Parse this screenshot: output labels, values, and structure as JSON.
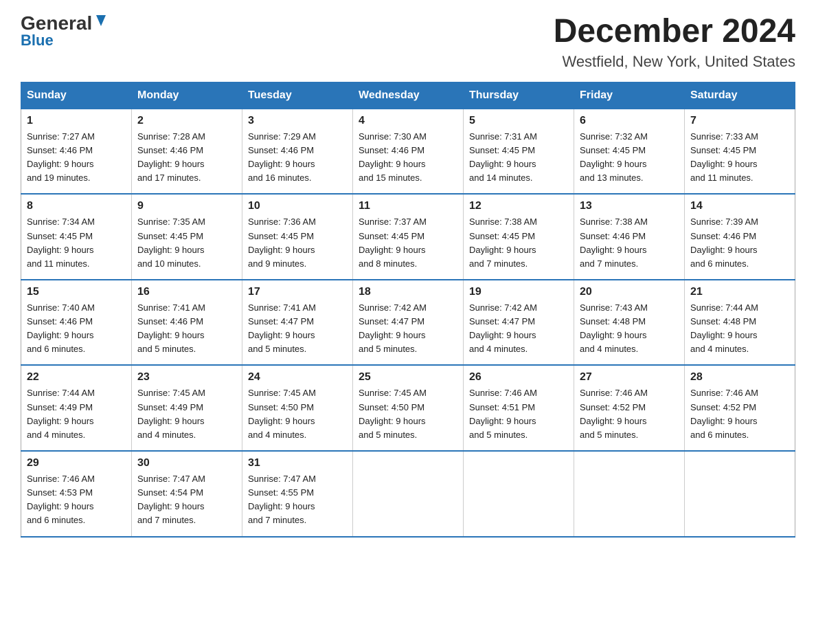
{
  "header": {
    "logo_general": "General",
    "logo_blue": "Blue",
    "month_title": "December 2024",
    "location": "Westfield, New York, United States"
  },
  "days_of_week": [
    "Sunday",
    "Monday",
    "Tuesday",
    "Wednesday",
    "Thursday",
    "Friday",
    "Saturday"
  ],
  "weeks": [
    [
      {
        "day": "1",
        "sunrise": "7:27 AM",
        "sunset": "4:46 PM",
        "daylight": "9 hours and 19 minutes."
      },
      {
        "day": "2",
        "sunrise": "7:28 AM",
        "sunset": "4:46 PM",
        "daylight": "9 hours and 17 minutes."
      },
      {
        "day": "3",
        "sunrise": "7:29 AM",
        "sunset": "4:46 PM",
        "daylight": "9 hours and 16 minutes."
      },
      {
        "day": "4",
        "sunrise": "7:30 AM",
        "sunset": "4:46 PM",
        "daylight": "9 hours and 15 minutes."
      },
      {
        "day": "5",
        "sunrise": "7:31 AM",
        "sunset": "4:45 PM",
        "daylight": "9 hours and 14 minutes."
      },
      {
        "day": "6",
        "sunrise": "7:32 AM",
        "sunset": "4:45 PM",
        "daylight": "9 hours and 13 minutes."
      },
      {
        "day": "7",
        "sunrise": "7:33 AM",
        "sunset": "4:45 PM",
        "daylight": "9 hours and 11 minutes."
      }
    ],
    [
      {
        "day": "8",
        "sunrise": "7:34 AM",
        "sunset": "4:45 PM",
        "daylight": "9 hours and 11 minutes."
      },
      {
        "day": "9",
        "sunrise": "7:35 AM",
        "sunset": "4:45 PM",
        "daylight": "9 hours and 10 minutes."
      },
      {
        "day": "10",
        "sunrise": "7:36 AM",
        "sunset": "4:45 PM",
        "daylight": "9 hours and 9 minutes."
      },
      {
        "day": "11",
        "sunrise": "7:37 AM",
        "sunset": "4:45 PM",
        "daylight": "9 hours and 8 minutes."
      },
      {
        "day": "12",
        "sunrise": "7:38 AM",
        "sunset": "4:45 PM",
        "daylight": "9 hours and 7 minutes."
      },
      {
        "day": "13",
        "sunrise": "7:38 AM",
        "sunset": "4:46 PM",
        "daylight": "9 hours and 7 minutes."
      },
      {
        "day": "14",
        "sunrise": "7:39 AM",
        "sunset": "4:46 PM",
        "daylight": "9 hours and 6 minutes."
      }
    ],
    [
      {
        "day": "15",
        "sunrise": "7:40 AM",
        "sunset": "4:46 PM",
        "daylight": "9 hours and 6 minutes."
      },
      {
        "day": "16",
        "sunrise": "7:41 AM",
        "sunset": "4:46 PM",
        "daylight": "9 hours and 5 minutes."
      },
      {
        "day": "17",
        "sunrise": "7:41 AM",
        "sunset": "4:47 PM",
        "daylight": "9 hours and 5 minutes."
      },
      {
        "day": "18",
        "sunrise": "7:42 AM",
        "sunset": "4:47 PM",
        "daylight": "9 hours and 5 minutes."
      },
      {
        "day": "19",
        "sunrise": "7:42 AM",
        "sunset": "4:47 PM",
        "daylight": "9 hours and 4 minutes."
      },
      {
        "day": "20",
        "sunrise": "7:43 AM",
        "sunset": "4:48 PM",
        "daylight": "9 hours and 4 minutes."
      },
      {
        "day": "21",
        "sunrise": "7:44 AM",
        "sunset": "4:48 PM",
        "daylight": "9 hours and 4 minutes."
      }
    ],
    [
      {
        "day": "22",
        "sunrise": "7:44 AM",
        "sunset": "4:49 PM",
        "daylight": "9 hours and 4 minutes."
      },
      {
        "day": "23",
        "sunrise": "7:45 AM",
        "sunset": "4:49 PM",
        "daylight": "9 hours and 4 minutes."
      },
      {
        "day": "24",
        "sunrise": "7:45 AM",
        "sunset": "4:50 PM",
        "daylight": "9 hours and 4 minutes."
      },
      {
        "day": "25",
        "sunrise": "7:45 AM",
        "sunset": "4:50 PM",
        "daylight": "9 hours and 5 minutes."
      },
      {
        "day": "26",
        "sunrise": "7:46 AM",
        "sunset": "4:51 PM",
        "daylight": "9 hours and 5 minutes."
      },
      {
        "day": "27",
        "sunrise": "7:46 AM",
        "sunset": "4:52 PM",
        "daylight": "9 hours and 5 minutes."
      },
      {
        "day": "28",
        "sunrise": "7:46 AM",
        "sunset": "4:52 PM",
        "daylight": "9 hours and 6 minutes."
      }
    ],
    [
      {
        "day": "29",
        "sunrise": "7:46 AM",
        "sunset": "4:53 PM",
        "daylight": "9 hours and 6 minutes."
      },
      {
        "day": "30",
        "sunrise": "7:47 AM",
        "sunset": "4:54 PM",
        "daylight": "9 hours and 7 minutes."
      },
      {
        "day": "31",
        "sunrise": "7:47 AM",
        "sunset": "4:55 PM",
        "daylight": "9 hours and 7 minutes."
      },
      null,
      null,
      null,
      null
    ]
  ]
}
